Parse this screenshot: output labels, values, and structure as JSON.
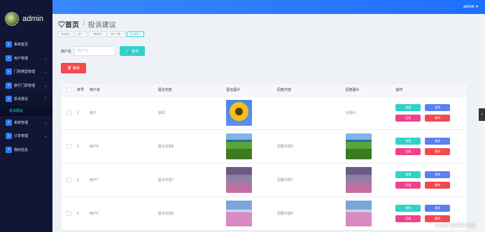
{
  "topbar": {
    "user": "admin ▾"
  },
  "sidebar": {
    "brand": "admin",
    "items": [
      {
        "label": "系统首页",
        "icon": "home-icon",
        "chev": ""
      },
      {
        "label": "用户管理",
        "icon": "user-icon",
        "chev": "⌄"
      },
      {
        "label": "门票类型管理",
        "icon": "ticket-icon",
        "chev": "⌄"
      },
      {
        "label": "旅行门票管理",
        "icon": "ticket-list-icon",
        "chev": "⌄"
      },
      {
        "label": "投诉建议",
        "icon": "feedback-icon",
        "chev": "⌃"
      }
    ],
    "submenu": "投诉建议",
    "items2": [
      {
        "label": "系统管理",
        "icon": "settings-icon",
        "chev": "⌄"
      },
      {
        "label": "订单管理",
        "icon": "order-icon",
        "chev": "⌄"
      },
      {
        "label": "我的信息",
        "icon": "profile-icon",
        "chev": ""
      }
    ]
  },
  "header": {
    "home": "♡首页",
    "sep": "/",
    "current": "投诉建议"
  },
  "tags": [
    "系统首页",
    "用户 ×",
    "门票类型 ×",
    "旅行门票 ×",
    "投诉建议 ×"
  ],
  "search": {
    "label": "用户名",
    "placeholder": "用户名",
    "button": "🔍 查询"
  },
  "delete_button": "🗑 删除",
  "table": {
    "headers": [
      "",
      "序号",
      "用户名",
      "留言内容",
      "留言图片",
      "回复内容",
      "回复图片",
      "操作"
    ],
    "rows": [
      {
        "no": "1",
        "user": "用户",
        "content": "测试",
        "reply": "",
        "reply_pic_text": "无图片"
      },
      {
        "no": "2",
        "user": "用户8",
        "content": "留言内容8",
        "reply": "回复内容8",
        "reply_pic_text": ""
      },
      {
        "no": "3",
        "user": "用户7",
        "content": "留言内容7",
        "reply": "回复内容7",
        "reply_pic_text": ""
      },
      {
        "no": "4",
        "user": "用户6",
        "content": "留言内容6",
        "reply": "回复内容6",
        "reply_pic_text": ""
      }
    ],
    "ops": {
      "view": "查看",
      "edit": "修改",
      "reply": "回复",
      "delete": "删除"
    }
  },
  "watermark": "CSDN @博时科技"
}
